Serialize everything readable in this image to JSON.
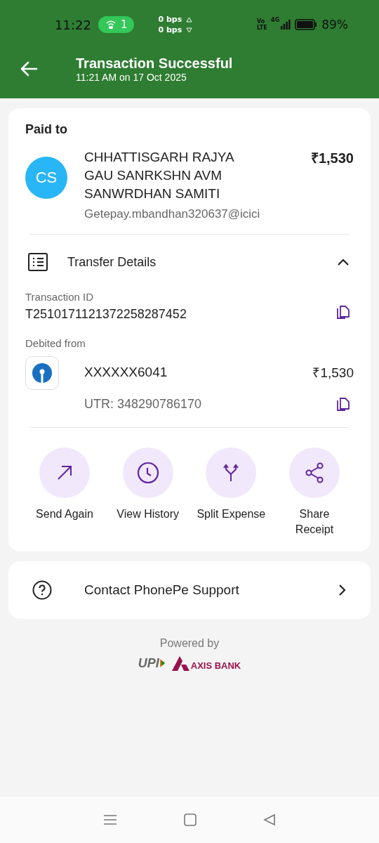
{
  "status_bar": {
    "time": "11:22",
    "hotspot_count": "1",
    "speed_up": "0 bps",
    "speed_down": "0 bps",
    "volte": "Vo LTE",
    "network": "4G",
    "battery": "89%"
  },
  "header": {
    "title": "Transaction Successful",
    "subtitle": "11:21 AM on 17 Oct 2025"
  },
  "paid_to": {
    "heading": "Paid to",
    "initials": "CS",
    "name": "CHHATTISGARH RAJYA GAU SANRKSHN AVM SANWRDHAN SAMITI",
    "amount": "₹1,530",
    "upi_id": "Getepay.mbandhan320637@icici"
  },
  "transfer_details": {
    "title": "Transfer Details",
    "expanded": true,
    "transaction_id_label": "Transaction ID",
    "transaction_id": "T2510171121372258287452",
    "debited_label": "Debited from",
    "account": "XXXXXX6041",
    "debited_amount": "₹1,530",
    "utr": "UTR: 348290786170"
  },
  "actions": [
    {
      "kind": "send",
      "label": "Send Again"
    },
    {
      "kind": "history",
      "label": "View History"
    },
    {
      "kind": "split",
      "label": "Split Expense"
    },
    {
      "kind": "share",
      "label": "Share Receipt"
    }
  ],
  "support": {
    "label": "Contact PhonePe Support"
  },
  "footer": {
    "powered_by": "Powered by",
    "upi_logo": "UPI",
    "bank_logo": "AXIS BANK"
  }
}
